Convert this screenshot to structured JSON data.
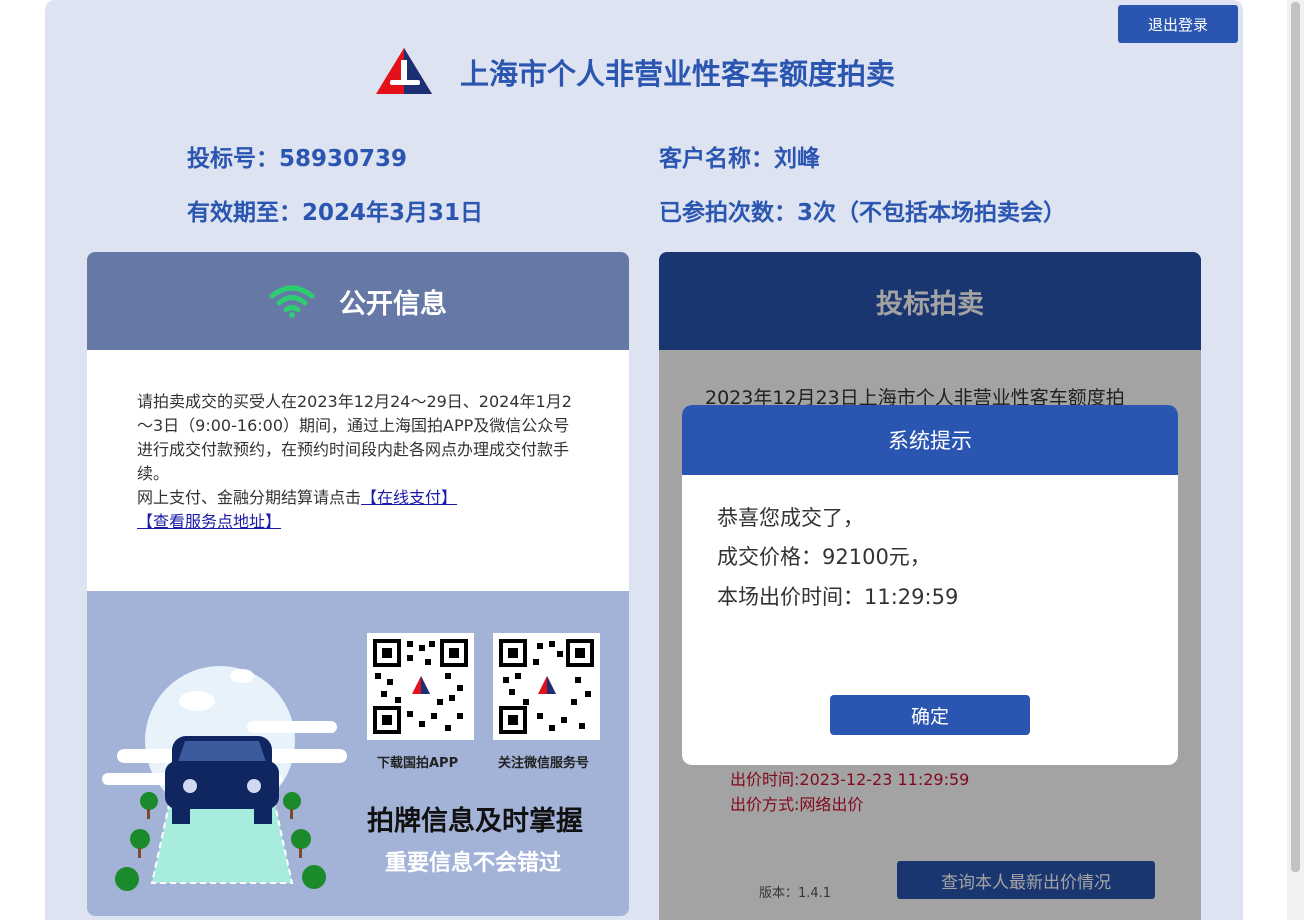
{
  "header": {
    "title": "上海市个人非营业性客车额度拍卖",
    "logout_label": "退出登录"
  },
  "info": {
    "bid_number": "投标号：58930739",
    "customer_name": "客户名称：刘峰",
    "valid_until": "有效期至：2024年3月31日",
    "participation_count": "已参拍次数：3次（不包括本场拍卖会）"
  },
  "public_info": {
    "title": "公开信息",
    "notice_text": "请拍卖成交的买受人在2023年12月24～29日、2024年1月2～3日（9:00-16:00）期间，通过上海国拍APP及微信公众号进行成交付款预约，在预约时间段内赴各网点办理成交付款手续。",
    "payment_prefix": "网上支付、金融分期结算请点击",
    "online_payment_link": "【在线支付】",
    "service_point_link": "【查看服务点地址】",
    "qr_app_label": "下载国拍APP",
    "qr_wechat_label": "关注微信服务号",
    "slogan_main": "拍牌信息及时掌握",
    "slogan_sub": "重要信息不会错过"
  },
  "auction": {
    "title": "投标拍卖",
    "text": "2023年12月23日上海市个人非营业性客车额度拍",
    "bid_time": "出价时间:2023-12-23 11:29:59",
    "bid_method": "出价方式:网络出价",
    "version": "版本：1.4.1",
    "query_label": "查询本人最新出价情况"
  },
  "modal": {
    "title": "系统提示",
    "line1": "恭喜您成交了，",
    "line2": "成交价格：92100元，",
    "line3": "本场出价时间：11:29:59",
    "confirm_label": "确定"
  },
  "colors": {
    "primary": "#2a55b0",
    "page_bg": "#dde3f1",
    "bid_text": "#c8102e",
    "wifi": "#2ecc71"
  }
}
